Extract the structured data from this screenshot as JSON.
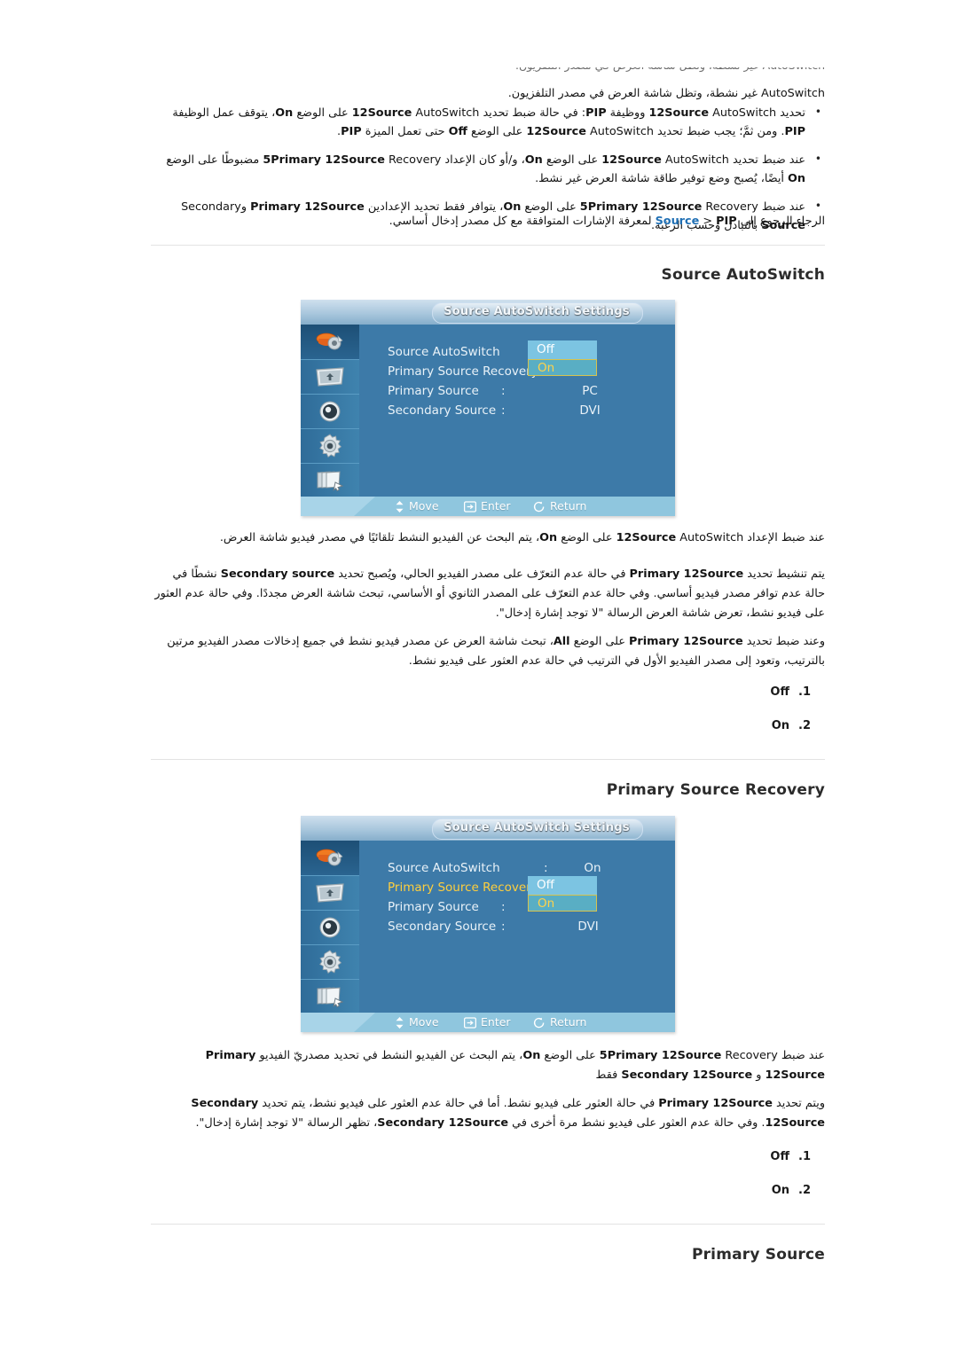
{
  "page": {
    "top_clipped_line": "AutoSwitch غير نشطة، وتظل شاشة العرض في مصدر التلفزيون.",
    "bullets": [
      "تحديد Source AutoSwitch ووظيفة PIP: في حالة ضبط تحديد Source AutoSwitch على الوضع On، يتوقف عمل الوظيفة PIP. ومن ثمَّ؛ يجب ضبط تحديد Source AutoSwitch على الوضع Off حتى تعمل الميزة PIP.",
      "عند ضبط تحديد Source AutoSwitch على الوضع On، و/أو كان الإعداد Primary Source Recovery مضبوطًا على الوضع On أيضًا، يُصبح وضع توفير طاقة شاشة العرض غير نشط.",
      "عند ضبط Primary Source Recovery على الوضع On، يتوافر فقط تحديد الإعدادين Primary Source وSecondary Source بالتبادل وحسب الرغبة."
    ],
    "note": "الرجاء الرجوع إلى Source > PIP لمعرفة الإشارات المتوافقة مع كل مصدر إدخال أساسي.",
    "note_link": "Source"
  },
  "section1": {
    "heading": "Source AutoSwitch",
    "osd": {
      "title": "Source AutoSwitch Settings",
      "rows": [
        {
          "label": "Source AutoSwitch",
          "value": "Off",
          "focused": false
        },
        {
          "label": "Primary Source Recovery",
          "value": "On",
          "focused": false
        },
        {
          "label": "Primary Source",
          "value": "PC",
          "focused": false
        },
        {
          "label": "Secondary Source",
          "value": "DVI",
          "focused": false
        }
      ],
      "dropdown": {
        "highlighted": "Off",
        "selected": "On"
      },
      "hints": [
        {
          "icon": "move-icon",
          "label": "Move"
        },
        {
          "icon": "enter-icon",
          "label": "Enter"
        },
        {
          "icon": "return-icon",
          "label": "Return"
        }
      ],
      "sidebar_icons": [
        "input-source-icon",
        "picture-icon",
        "sound-icon",
        "setup-icon",
        "multi-control-icon"
      ]
    },
    "paragraphs": [
      "عند ضبط الإعداد Source AutoSwitch على الوضع On، يتم البحث عن الفيديو النشط تلقائيًا في مصدر فيديو شاشة العرض.",
      "يتم تنشيط تحديد Primary Source في حالة عدم التعرّف على مصدر الفيديو الحالي، ويُصبح تحديد Secondary source نشطًا في حالة عدم توافر مصدر فيديو أساسي. وفي حالة عدم التعرّف على المصدر الثانوي أو الأساسي، تبحث شاشة العرض مجددًا. وفي حالة عدم العثور على فيديو نشط، تعرض شاشة العرض الرسالة \"لا توجد إشارة إدخال\".",
      "وعند ضبط تحديد Primary Source على الوضع All، تبحث شاشة العرض عن مصدر فيديو نشط في جميع إدخالات مصدر الفيديو مرتين بالترتيب، وتعود إلى مصدر الفيديو الأول في الترتيب في حالة عدم العثور على فيديو نشط."
    ],
    "options": [
      {
        "num": "1.",
        "label": "Off"
      },
      {
        "num": "2.",
        "label": "On"
      }
    ]
  },
  "section2": {
    "heading": "Primary Source Recovery",
    "osd": {
      "title": "Source AutoSwitch Settings",
      "rows": [
        {
          "label": "Source AutoSwitch",
          "value": "On",
          "focused": false
        },
        {
          "label": "Primary Source Recovery",
          "value": "",
          "focused": true
        },
        {
          "label": "Primary Source",
          "value": "",
          "focused": false
        },
        {
          "label": "Secondary Source",
          "value": "DVI",
          "focused": false
        }
      ],
      "dropdown": {
        "highlighted": "Off",
        "selected": "On"
      },
      "hints": [
        {
          "icon": "move-icon",
          "label": "Move"
        },
        {
          "icon": "enter-icon",
          "label": "Enter"
        },
        {
          "icon": "return-icon",
          "label": "Return"
        }
      ],
      "sidebar_icons": [
        "input-source-icon",
        "picture-icon",
        "sound-icon",
        "setup-icon",
        "multi-control-icon"
      ]
    },
    "paragraphs": [
      "عند ضبط Primary Source Recovery على الوضع On، يتم البحث عن الفيديو النشط في تحديد مصدريّ الفيديو Primary Source و Secondary Source فقط",
      "ويتم تحديد Primary Source في حالة العثور على فيديو نشط. أما في حالة عدم العثور على فيديو نشط، يتم تحديد Secondary Source. وفي حالة عدم العثور على فيديو نشط مرة أخرى في Secondary Source، تظهر الرسالة \"لا توجد إشارة إدخال\"."
    ],
    "options": [
      {
        "num": "1.",
        "label": "Off"
      },
      {
        "num": "2.",
        "label": "On"
      }
    ]
  },
  "section3": {
    "heading": "Primary Source"
  }
}
